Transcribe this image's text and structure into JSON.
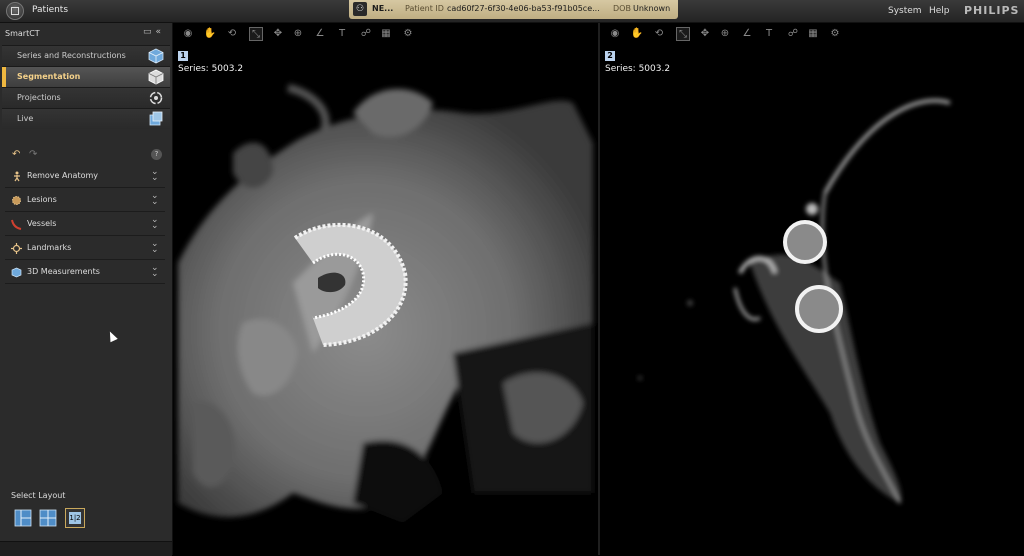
{
  "topbar": {
    "patients_label": "Patients",
    "patient_name": "NE...",
    "patient_id_label": "Patient ID",
    "patient_id_value": "cad60f27-6f30-4e06-ba53-f91b05ce...",
    "dob_label": "DOB",
    "dob_value": "Unknown",
    "menu_system": "System",
    "menu_help": "Help",
    "brand": "PHILIPS"
  },
  "left_panel": {
    "title": "SmartCT",
    "workflow_items": [
      {
        "label": "Series and Reconstructions",
        "icon": "cube-icon",
        "active": false
      },
      {
        "label": "Segmentation",
        "icon": "segmentation-cube-icon",
        "active": true
      },
      {
        "label": "Projections",
        "icon": "rotate-icon",
        "active": false
      },
      {
        "label": "Live",
        "icon": "live-icon",
        "active": false
      }
    ],
    "tools": [
      {
        "label": "Remove Anatomy",
        "icon": "remove-anatomy-icon"
      },
      {
        "label": "Lesions",
        "icon": "lesion-icon"
      },
      {
        "label": "Vessels",
        "icon": "vessel-icon"
      },
      {
        "label": "Landmarks",
        "icon": "landmark-icon"
      },
      {
        "label": "3D Measurements",
        "icon": "measurement-3d-icon"
      }
    ],
    "select_layout_label": "Select Layout",
    "layout_icons": [
      "layout-2x1-icon",
      "layout-2x2-icon",
      "layout-1-2-icon"
    ],
    "layout_active_text": "1|2"
  },
  "viewports": [
    {
      "number": "1",
      "series": "Series: 5003.2"
    },
    {
      "number": "2",
      "series": "Series: 5003.2"
    }
  ],
  "colors": {
    "accent": "#f0b840",
    "banner": "#cfc09a",
    "viewport_badge": "#bcd3ee"
  }
}
